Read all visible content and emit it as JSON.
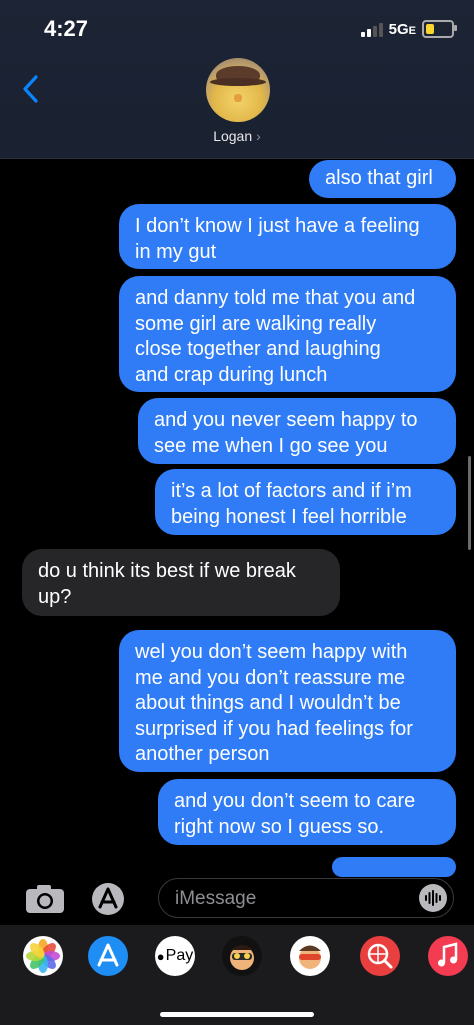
{
  "status_bar": {
    "time": "4:27",
    "network": "5G",
    "network_suffix": "E",
    "battery_level": 0.35
  },
  "header": {
    "contact_name": "Logan",
    "avatar_icon": "parrot-with-cowboy-hat-avatar"
  },
  "messages": [
    {
      "direction": "sent",
      "text": "also that girl"
    },
    {
      "direction": "sent",
      "text": "I don’t know I just have a feeling\nin my gut"
    },
    {
      "direction": "sent",
      "text": "and danny told me that you and\nsome girl are walking really\nclose together and laughing\nand crap during lunch"
    },
    {
      "direction": "sent",
      "text": "and you never seem happy to\nsee me when I go see you"
    },
    {
      "direction": "sent",
      "text": "it’s a lot of factors and if i’m\nbeing honest I feel horrible"
    },
    {
      "direction": "received",
      "text": "do u think its best if we break\nup?"
    },
    {
      "direction": "sent",
      "text": "wel you don’t seem happy with\nme and you don’t reassure me\nabout things and I wouldn’t be\nsurprised if you had feelings for\nanother person"
    },
    {
      "direction": "sent",
      "text": "and you don’t seem to care\nright now so I guess so."
    }
  ],
  "input": {
    "placeholder": "iMessage"
  },
  "app_drawer": [
    {
      "name": "photos",
      "icon": "photos-icon"
    },
    {
      "name": "app-store",
      "icon": "app-store-icon"
    },
    {
      "name": "apple-pay",
      "label": "Pay",
      "icon": "apple-pay-icon"
    },
    {
      "name": "memoji-1",
      "icon": "memoji-icon"
    },
    {
      "name": "memoji-2",
      "icon": "memoji-icon"
    },
    {
      "name": "web-search",
      "icon": "search-globe-icon"
    },
    {
      "name": "music",
      "icon": "music-icon"
    }
  ],
  "colors": {
    "sent_bubble": "#2f7cf6",
    "received_bubble": "#262629",
    "accent": "#0a84ff"
  }
}
